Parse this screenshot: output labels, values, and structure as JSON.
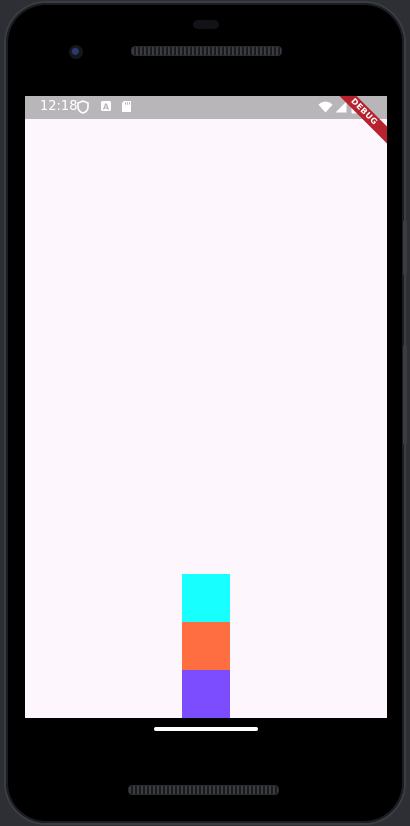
{
  "status_bar": {
    "time": "12:18",
    "left_icons": [
      "shield-icon",
      "a-notification-icon",
      "sd-card-icon"
    ],
    "right_icons": [
      "wifi-icon",
      "signal-icon",
      "battery-icon"
    ],
    "debug_banner": "DEBUG"
  },
  "app": {
    "background_color": "#fdf6fd",
    "boxes": [
      {
        "name": "cyan-box",
        "color": "#18ffff"
      },
      {
        "name": "orange-box",
        "color": "#ff6e40"
      },
      {
        "name": "purple-box",
        "color": "#7c4dff"
      }
    ]
  },
  "colors": {
    "status_bar": "#b9b6ba",
    "debug_ribbon": "#b6222d"
  }
}
